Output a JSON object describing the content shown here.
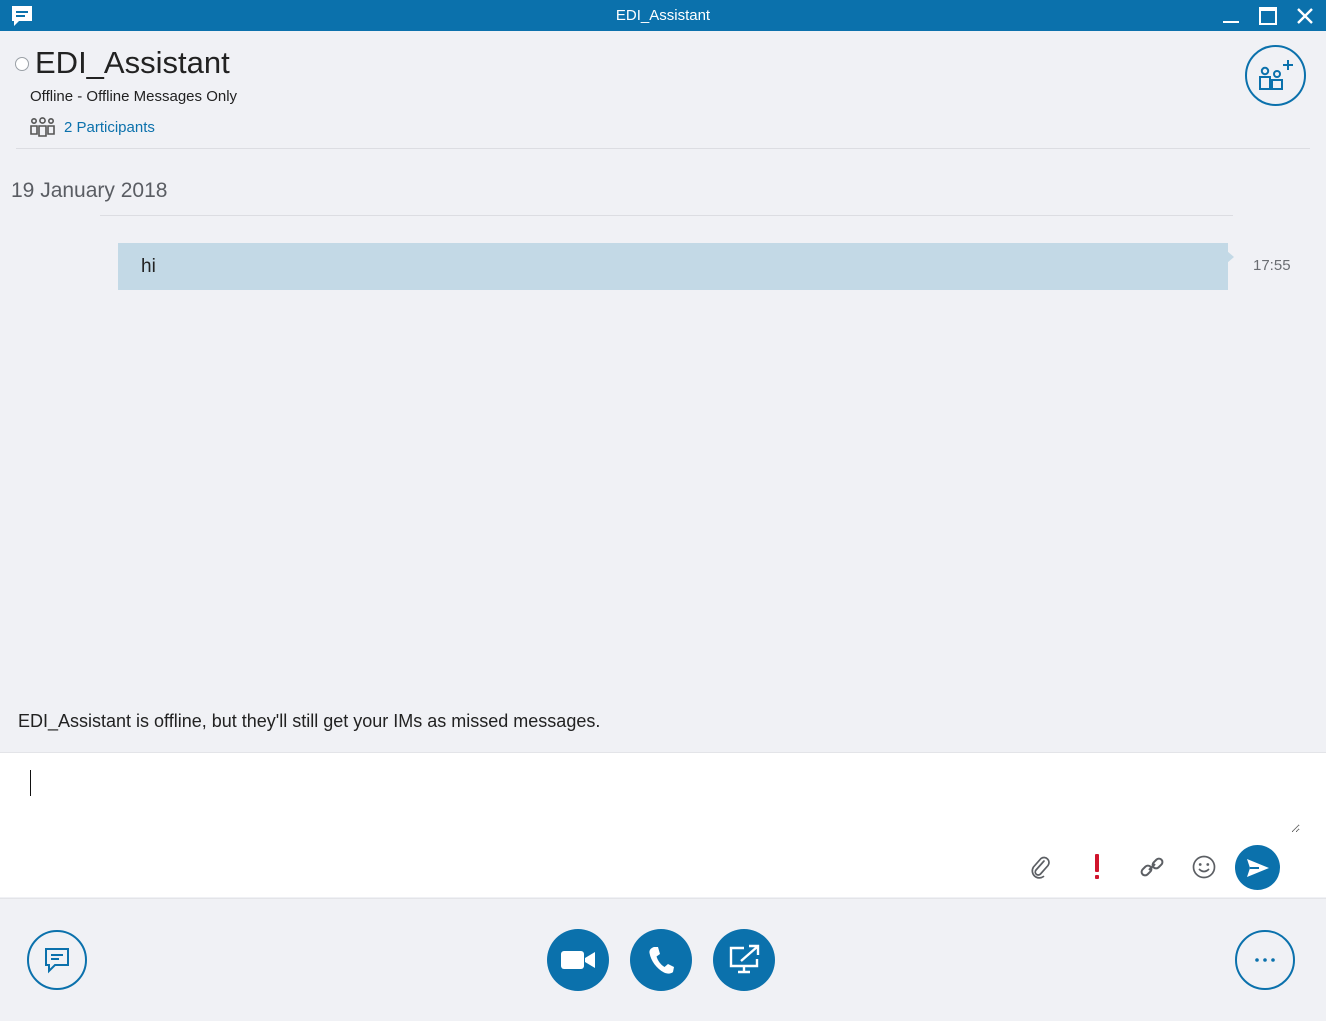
{
  "window": {
    "title": "EDI_Assistant",
    "icons": [
      "chat-app-icon",
      "minimize-icon",
      "maximize-icon",
      "close-icon"
    ]
  },
  "conversation": {
    "contact_name": "EDI_Assistant",
    "status": "Offline - Offline Messages Only",
    "participants_label": "2 Participants",
    "add_people_icon": "add-people-icon"
  },
  "messages": {
    "date": "19 January 2018",
    "items": [
      {
        "text": "hi",
        "time": "17:55"
      }
    ]
  },
  "notice": "EDI_Assistant is offline, but they'll still get your IMs as missed messages.",
  "compose": {
    "value": "",
    "icons": [
      "paperclip-icon",
      "important-icon",
      "link-icon",
      "emoticon-icon",
      "send-icon"
    ]
  },
  "bottom_bar": {
    "icons": [
      "im-icon",
      "video-icon",
      "phone-icon",
      "present-screen-icon",
      "more-options-icon"
    ]
  },
  "colors": {
    "accent": "#0b71ac",
    "background": "#f0f1f5",
    "bubble": "#c3d9e6",
    "important": "#d0142c"
  }
}
